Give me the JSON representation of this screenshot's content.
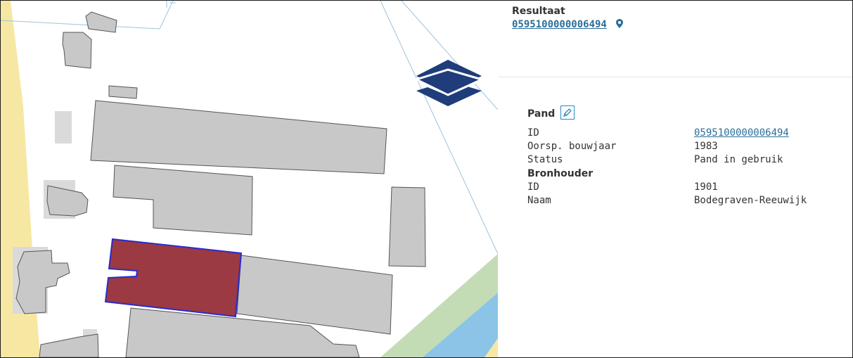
{
  "result": {
    "title": "Resultaat",
    "id_link": "0595100000006494"
  },
  "pand": {
    "title": "Pand",
    "rows": [
      {
        "label": "ID",
        "value": "0595100000006494",
        "link": true
      },
      {
        "label": "Oorsp. bouwjaar",
        "value": "1983",
        "link": false
      },
      {
        "label": "Status",
        "value": "Pand in gebruik",
        "link": false
      }
    ]
  },
  "bronhouder": {
    "title": "Bronhouder",
    "rows": [
      {
        "label": "ID",
        "value": "1901"
      },
      {
        "label": "Naam",
        "value": "Bodegraven-Reeuwijk"
      }
    ]
  },
  "icons": {
    "layers": "layers-icon",
    "pin": "map-pin-icon",
    "edit": "pencil-icon"
  },
  "colors": {
    "selected_building": "#9b3a42",
    "selected_outline": "#2a2ad0",
    "building": "#c8c8c8",
    "water": "#8cc4e8",
    "grass": "#c3dcb6",
    "layers_icon": "#1f3d7a",
    "link": "#2a6f9a"
  }
}
